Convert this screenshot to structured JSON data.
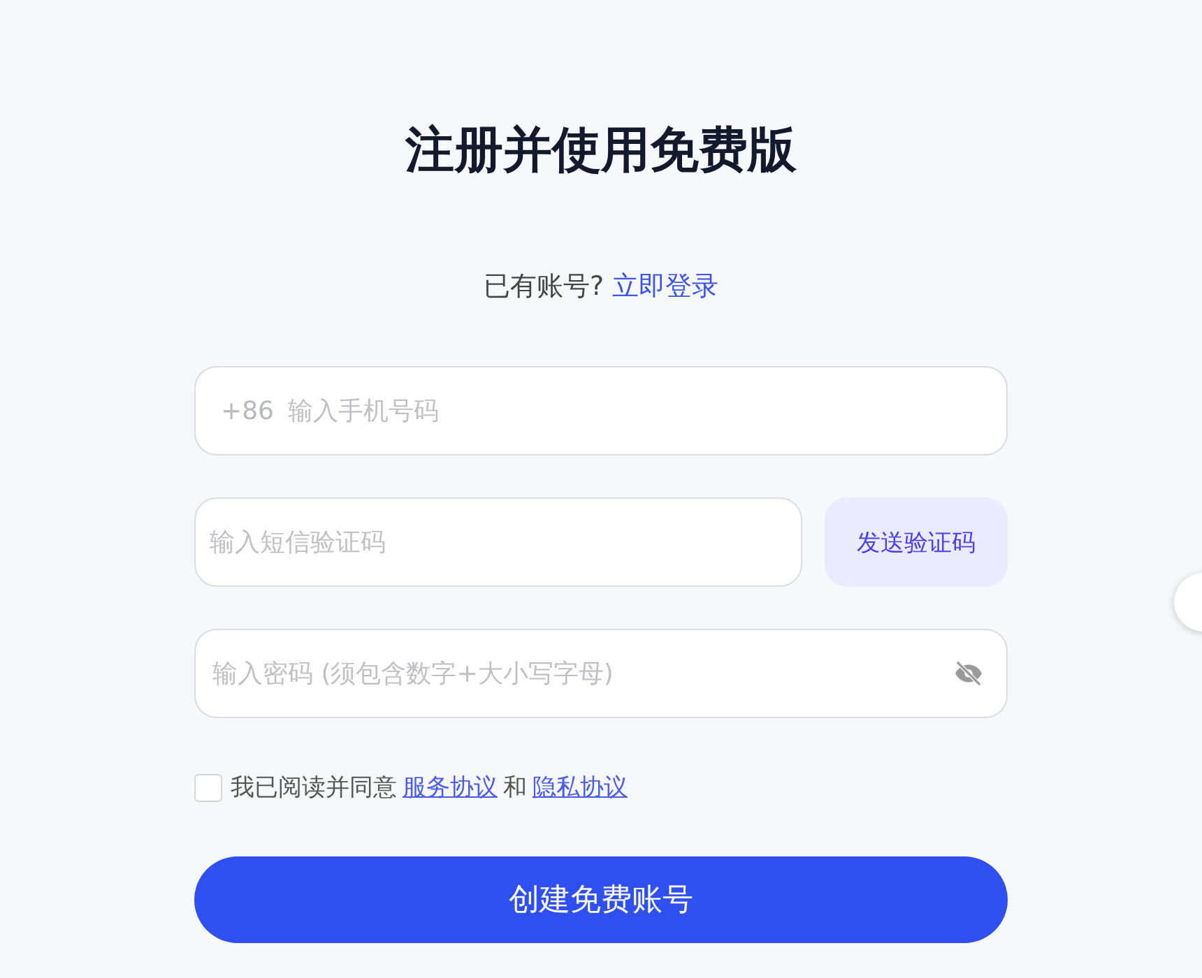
{
  "title": "注册并使用免费版",
  "login_prompt": {
    "text": "已有账号?",
    "link": "立即登录"
  },
  "phone": {
    "prefix": "+86",
    "placeholder": "输入手机号码"
  },
  "code": {
    "placeholder": "输入短信验证码",
    "button": "发送验证码"
  },
  "password": {
    "placeholder": "输入密码 (须包含数字+大小写字母)",
    "visible": false
  },
  "agreement": {
    "checked": false,
    "text": "我已阅读并同意",
    "link1": "服务协议",
    "joiner": "和",
    "link2": "隐私协议"
  },
  "submit": "创建免费账号"
}
